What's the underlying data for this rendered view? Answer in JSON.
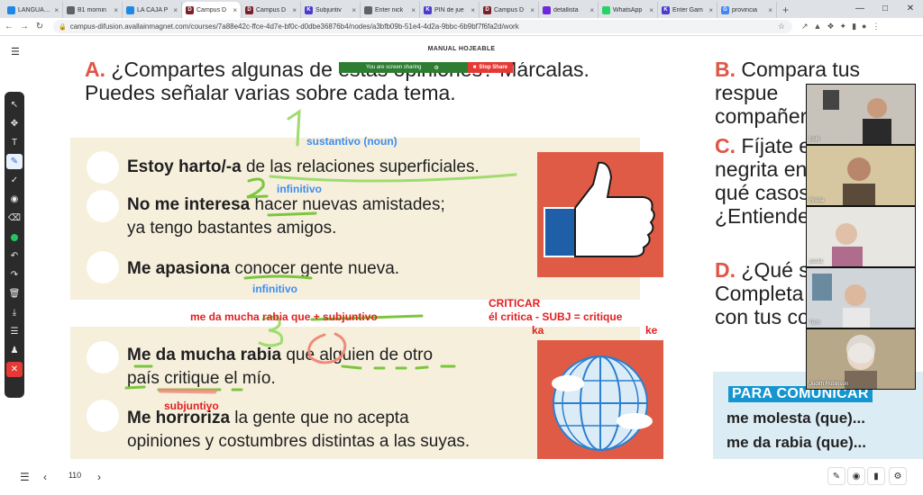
{
  "browser": {
    "tabs": [
      {
        "label": "LANGUAGE",
        "color": "#1e88e5",
        "glyph": ""
      },
      {
        "label": "B1 mornin",
        "color": "#5f6368",
        "glyph": ""
      },
      {
        "label": "LA CAJA P",
        "color": "#1e88e5",
        "glyph": ""
      },
      {
        "label": "Campus D",
        "color": "#7b1f2a",
        "glyph": "D"
      },
      {
        "label": "Campus D",
        "color": "#7b1f2a",
        "glyph": "D"
      },
      {
        "label": "Subjuntiv",
        "color": "#4b3bd1",
        "glyph": "K"
      },
      {
        "label": "Enter nick",
        "color": "#5f6368",
        "glyph": ""
      },
      {
        "label": "PIN de jue",
        "color": "#4b3bd1",
        "glyph": "K"
      },
      {
        "label": "Campus D",
        "color": "#7b1f2a",
        "glyph": "D"
      },
      {
        "label": "detallista",
        "color": "#6d28d9",
        "glyph": ""
      },
      {
        "label": "WhatsApp",
        "color": "#25d366",
        "glyph": ""
      },
      {
        "label": "Enter Gam",
        "color": "#4b3bd1",
        "glyph": "K"
      },
      {
        "label": "provincia",
        "color": "#4285f4",
        "glyph": "G"
      }
    ],
    "active_tab": 3,
    "url": "campus-difusion.avallainmagnet.com/courses/7a88e42c-ffce-4d7e-bf0c-d0dbe36876b4/nodes/a3bfb09b-51e4-4d2a-9bbc-6b9bf7f6fa2d/work"
  },
  "app": {
    "book_title": "MANUAL HOJEABLE",
    "share_text": "You are screen sharing",
    "stop_share": "Stop Share"
  },
  "content": {
    "qa_letter": "A.",
    "qa_line1": "¿Compartes algunas de estas opiniones? Márcalas.",
    "qa_line2": "Puedes señalar varias sobre cada tema.",
    "qb_letter": "B.",
    "qb_line1": "Compara tus respue",
    "qb_line2": "compañer",
    "qc_letter": "C.",
    "qc_line1": "Fíjate e",
    "qc_line2": "negrita en",
    "qc_line3": "qué casos",
    "qc_line4": "¿Entiendes",
    "qd_letter": "D.",
    "qd_line1": "¿Qué si",
    "qd_line2": "Completa",
    "qd_line3": "con tus co",
    "s1_bold": "Estoy harto/-a",
    "s1_rest": " de las relaciones superficiales.",
    "s2_bold": "No me interesa",
    "s2_rest": " hacer nuevas amistades;",
    "s2_line2": "ya tengo bastantes amigos.",
    "s3_bold": "Me apasiona",
    "s3_rest": " conocer gente nueva.",
    "s4_bold": "Me da mucha rabia",
    "s4_rest": " que alguien de otro",
    "s4_line2": "país critique el mío.",
    "s5_bold": "Me horroriza",
    "s5_rest": " la gente que no acepta",
    "s5_line2": "opiniones y costumbres distintas a las suyas.",
    "para_title": "PARA COMUNICAR",
    "para_line1": "me molesta (que)...",
    "para_line2": "me da rabia (que)..."
  },
  "annotations": {
    "sustantivo": "sustantivo (noun)",
    "infinitivo1": "infinitivo",
    "infinitivo2": "infinitivo",
    "rabia_rule": "me da mucha rabia que + subjuntivo",
    "criticar": "CRITICAR",
    "critica_line": "él critica  - SUBJ = critique",
    "ka": "ka",
    "ke": "ke",
    "subjuntivo": "subjuntiyo",
    "num1": "1",
    "num2": "2",
    "num3": "3",
    "blue_color": "#3d8ef0",
    "red_color": "#e02020",
    "green_color": "#7cc63f"
  },
  "participants": [
    {
      "name": "Lolo"
    },
    {
      "name": "Breda"
    },
    {
      "name": "paula"
    },
    {
      "name": "Terri"
    },
    {
      "name": "Judith Robinson"
    }
  ],
  "toolbar_tools": [
    "pointer-icon",
    "move-icon",
    "text-icon",
    "pen-icon",
    "check-icon",
    "stamp-icon",
    "eraser-icon",
    "color-icon",
    "undo-icon",
    "redo-icon",
    "trash-icon",
    "download-icon",
    "menu-icon",
    "users-icon",
    "close-icon"
  ],
  "footer": {
    "page_number": "110"
  }
}
